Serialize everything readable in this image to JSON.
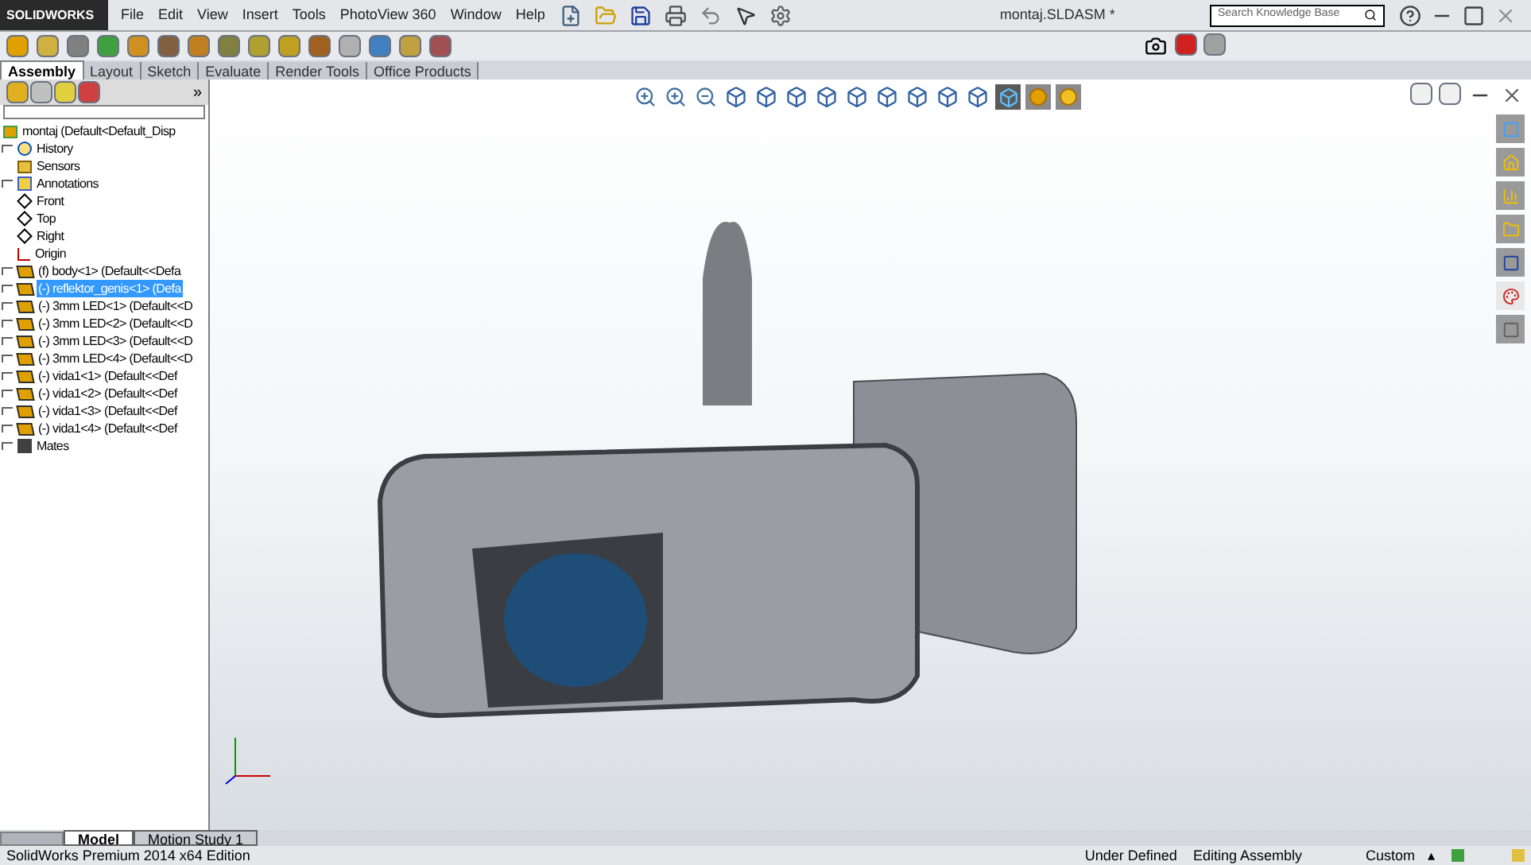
{
  "app": {
    "logo": "SOLIDWORKS",
    "title": "montaj.SLDASM *"
  },
  "menu": [
    "File",
    "Edit",
    "View",
    "Insert",
    "Tools",
    "PhotoView 360",
    "Window",
    "Help"
  ],
  "search": {
    "placeholder": "Search Knowledge Base"
  },
  "command_tabs": [
    {
      "label": "Assembly",
      "selected": true
    },
    {
      "label": "Layout",
      "selected": false
    },
    {
      "label": "Sketch",
      "selected": false
    },
    {
      "label": "Evaluate",
      "selected": false
    },
    {
      "label": "Render Tools",
      "selected": false
    },
    {
      "label": "Office Products",
      "selected": false
    }
  ],
  "panel": {
    "collapse": "»"
  },
  "tree": {
    "root": "montaj  (Default<Default_Disp",
    "children": [
      {
        "label": "History",
        "kind": "history",
        "expandable": true,
        "selected": false
      },
      {
        "label": "Sensors",
        "kind": "sensors",
        "expandable": false,
        "selected": false
      },
      {
        "label": "Annotations",
        "kind": "annotations",
        "expandable": true,
        "selected": false
      },
      {
        "label": "Front",
        "kind": "plane",
        "expandable": false,
        "selected": false
      },
      {
        "label": "Top",
        "kind": "plane",
        "expandable": false,
        "selected": false
      },
      {
        "label": "Right",
        "kind": "plane",
        "expandable": false,
        "selected": false
      },
      {
        "label": "Origin",
        "kind": "origin",
        "expandable": false,
        "selected": false
      },
      {
        "label": "(f) body<1> (Default<<Defa",
        "kind": "part",
        "expandable": true,
        "selected": false
      },
      {
        "label": "(-) reflektor_genis<1> (Defa",
        "kind": "part",
        "expandable": true,
        "selected": true
      },
      {
        "label": "(-) 3mm LED<1> (Default<<D",
        "kind": "part",
        "expandable": true,
        "selected": false
      },
      {
        "label": "(-) 3mm LED<2> (Default<<D",
        "kind": "part",
        "expandable": true,
        "selected": false
      },
      {
        "label": "(-) 3mm LED<3> (Default<<D",
        "kind": "part",
        "expandable": true,
        "selected": false
      },
      {
        "label": "(-) 3mm LED<4> (Default<<D",
        "kind": "part",
        "expandable": true,
        "selected": false
      },
      {
        "label": "(-) vida1<1> (Default<<Def",
        "kind": "part",
        "expandable": true,
        "selected": false
      },
      {
        "label": "(-) vida1<2> (Default<<Def",
        "kind": "part",
        "expandable": true,
        "selected": false
      },
      {
        "label": "(-) vida1<3> (Default<<Def",
        "kind": "part",
        "expandable": true,
        "selected": false
      },
      {
        "label": "(-) vida1<4> (Default<<Def",
        "kind": "part",
        "expandable": true,
        "selected": false
      },
      {
        "label": "Mates",
        "kind": "mates",
        "expandable": true,
        "selected": false
      }
    ]
  },
  "task_pane": [
    {
      "selected": false
    },
    {
      "selected": false
    },
    {
      "selected": false
    },
    {
      "selected": false
    },
    {
      "selected": false
    },
    {
      "selected": true
    },
    {
      "selected": false
    }
  ],
  "bottom_tabs": [
    {
      "label": "Model",
      "selected": true
    },
    {
      "label": "Motion Study 1",
      "selected": false
    }
  ],
  "status_bar": {
    "edition": "SolidWorks Premium 2014 x64 Edition",
    "state": "Under Defined",
    "mode": "Editing Assembly",
    "units": "Custom",
    "units_caret": "▴"
  }
}
